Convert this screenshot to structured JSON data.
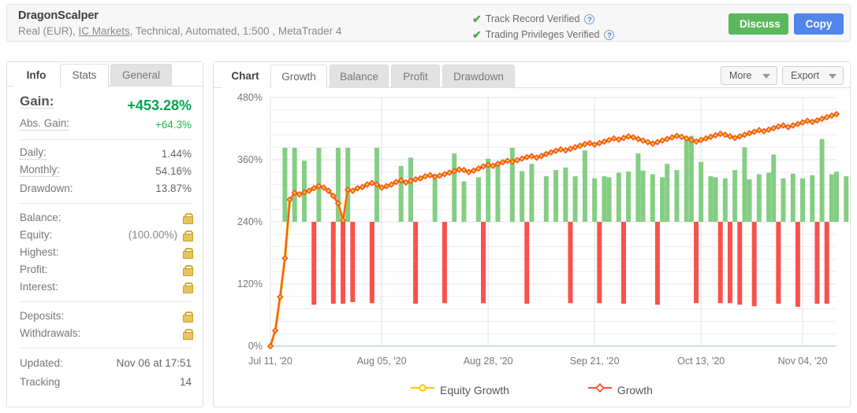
{
  "header": {
    "title": "DragonScalper",
    "subtitle_parts": {
      "pre": "Real (EUR), ",
      "broker": "IC Markets",
      "post": ", Technical, Automated, 1:500 , MetaTrader 4"
    },
    "verified": [
      {
        "label": "Track Record Verified",
        "help": "?"
      },
      {
        "label": "Trading Privileges Verified",
        "help": "?"
      }
    ],
    "discuss_label": "Discuss",
    "copy_label": "Copy",
    "discuss_color": "#5cb85c",
    "copy_color": "#5285ec"
  },
  "left_panel": {
    "tabs": [
      {
        "label": "Info",
        "state": "title"
      },
      {
        "label": "Stats",
        "state": "active"
      },
      {
        "label": "General",
        "state": "inactive"
      }
    ],
    "gain": {
      "label": "Gain:",
      "value": "+453.28%"
    },
    "abs_gain": {
      "label": "Abs. Gain:",
      "value": "+64.3%"
    },
    "metrics": [
      {
        "label": "Daily:",
        "value": "1.44%"
      },
      {
        "label": "Monthly:",
        "value": "54.16%"
      },
      {
        "label": "Drawdown:",
        "value": "13.87%"
      }
    ],
    "locked": [
      {
        "label": "Balance:",
        "value": "",
        "lock": "lock-icon"
      },
      {
        "label": "Equity:",
        "value": "(100.00%)",
        "lock": "lock-icon"
      },
      {
        "label": "Highest:",
        "value": "",
        "lock": "lock-icon"
      },
      {
        "label": "Profit:",
        "value": "",
        "lock": "lock-icon"
      },
      {
        "label": "Interest:",
        "value": "",
        "lock": "lock-icon"
      }
    ],
    "funds": [
      {
        "label": "Deposits:",
        "value": "",
        "lock": "lock-icon"
      },
      {
        "label": "Withdrawals:",
        "value": "",
        "lock": "lock-icon"
      }
    ],
    "footer": [
      {
        "label": "Updated:",
        "value": "Nov 06 at 17:51"
      },
      {
        "label": "Tracking",
        "value": "14"
      }
    ]
  },
  "right_panel": {
    "tabs": [
      {
        "label": "Chart",
        "state": "title"
      },
      {
        "label": "Growth",
        "state": "active"
      },
      {
        "label": "Balance",
        "state": "inactive"
      },
      {
        "label": "Profit",
        "state": "inactive"
      },
      {
        "label": "Drawdown",
        "state": "inactive"
      }
    ],
    "more_label": "More",
    "export_label": "Export"
  },
  "chart_data": {
    "type": "line",
    "title": "Growth",
    "xlabel": "",
    "ylabel": "",
    "grid": true,
    "legend_position": "bottom",
    "ylim": [
      0,
      480
    ],
    "yticks": [
      0,
      120,
      240,
      360,
      480
    ],
    "ytick_labels": [
      "0%",
      "120%",
      "240%",
      "360%",
      "480%"
    ],
    "xtick_labels": [
      "Jul 11, '20",
      "Aug 05, '20",
      "Aug 28, '20",
      "Sep 21, '20",
      "Oct 13, '20",
      "Nov 04, '20"
    ],
    "xtick_positions": [
      0,
      23,
      45,
      67,
      89,
      110
    ],
    "x_count": 118,
    "bar_baseline": 240,
    "colors": {
      "growth_line": "#f4542e",
      "growth_marker_fill": "#ffd400",
      "equity_growth": "#ffc600",
      "bar_up": "#84ce84",
      "bar_down": "#f9514b",
      "grid": "#ededed",
      "axis": "#c6d0e8"
    },
    "series": [
      {
        "name": "Equity Growth",
        "color": "#ffc600",
        "type": "line",
        "note": "overlaps Growth line"
      },
      {
        "name": "Growth",
        "color": "#f4542e",
        "type": "line",
        "values": [
          0,
          30,
          95,
          170,
          283,
          296,
          293,
          297,
          300,
          305,
          309,
          306,
          300,
          290,
          276,
          243,
          302,
          300,
          305,
          307,
          312,
          315,
          312,
          306,
          309,
          312,
          317,
          320,
          316,
          319,
          322,
          324,
          328,
          330,
          327,
          329,
          332,
          335,
          338,
          341,
          340,
          336,
          339,
          343,
          347,
          350,
          348,
          352,
          355,
          358,
          356,
          359,
          362,
          365,
          367,
          364,
          367,
          371,
          374,
          377,
          380,
          378,
          381,
          384,
          387,
          390,
          392,
          389,
          392,
          395,
          398,
          401,
          399,
          402,
          405,
          403,
          400,
          397,
          394,
          391,
          394,
          397,
          400,
          403,
          406,
          404,
          401,
          398,
          395,
          398,
          401,
          404,
          407,
          410,
          408,
          405,
          402,
          405,
          408,
          411,
          414,
          417,
          415,
          418,
          421,
          424,
          426,
          423,
          426,
          429,
          432,
          435,
          433,
          436,
          439,
          442,
          445,
          448
        ]
      },
      {
        "name": "Up bars",
        "color": "#84ce84",
        "type": "bar",
        "note": "green bars drawn upward from 240% baseline"
      },
      {
        "name": "Down bars",
        "color": "#f9514b",
        "type": "bar",
        "note": "red bars drawn downward from 240% baseline"
      }
    ],
    "bars": [
      {
        "i": 3,
        "up": 143
      },
      {
        "i": 5,
        "up": 143
      },
      {
        "i": 7,
        "up": 118
      },
      {
        "i": 10,
        "up": 143
      },
      {
        "i": 14,
        "up": 143
      },
      {
        "i": 16,
        "up": 143
      },
      {
        "i": 22,
        "up": 143
      },
      {
        "i": 27,
        "up": 108
      },
      {
        "i": 29,
        "up": 124
      },
      {
        "i": 34,
        "up": 92
      },
      {
        "i": 38,
        "up": 132
      },
      {
        "i": 40,
        "up": 78
      },
      {
        "i": 43,
        "up": 86
      },
      {
        "i": 45,
        "up": 122
      },
      {
        "i": 47,
        "up": 112
      },
      {
        "i": 50,
        "up": 143
      },
      {
        "i": 52,
        "up": 98
      },
      {
        "i": 54,
        "up": 112
      },
      {
        "i": 57,
        "up": 88
      },
      {
        "i": 59,
        "up": 100
      },
      {
        "i": 61,
        "up": 105
      },
      {
        "i": 63,
        "up": 88
      },
      {
        "i": 65,
        "up": 138
      },
      {
        "i": 67,
        "up": 84
      },
      {
        "i": 69,
        "up": 88
      },
      {
        "i": 70,
        "up": 86
      },
      {
        "i": 72,
        "up": 95
      },
      {
        "i": 74,
        "up": 97
      },
      {
        "i": 76,
        "up": 132
      },
      {
        "i": 77,
        "up": 99
      },
      {
        "i": 79,
        "up": 92
      },
      {
        "i": 81,
        "up": 86
      },
      {
        "i": 82,
        "up": 112
      },
      {
        "i": 84,
        "up": 100
      },
      {
        "i": 86,
        "up": 160
      },
      {
        "i": 87,
        "up": 166
      },
      {
        "i": 89,
        "up": 116
      },
      {
        "i": 91,
        "up": 88
      },
      {
        "i": 92,
        "up": 86
      },
      {
        "i": 94,
        "up": 84
      },
      {
        "i": 96,
        "up": 100
      },
      {
        "i": 98,
        "up": 144
      },
      {
        "i": 99,
        "up": 82
      },
      {
        "i": 101,
        "up": 92
      },
      {
        "i": 103,
        "up": 95
      },
      {
        "i": 104,
        "up": 130
      },
      {
        "i": 106,
        "up": 84
      },
      {
        "i": 108,
        "up": 93
      },
      {
        "i": 110,
        "up": 84
      },
      {
        "i": 112,
        "up": 90
      },
      {
        "i": 114,
        "up": 160
      },
      {
        "i": 116,
        "up": 92
      },
      {
        "i": 117,
        "up": 97
      },
      {
        "i": 119,
        "up": 88
      },
      {
        "i": 121,
        "up": 103
      },
      {
        "i": 9,
        "down": 160
      },
      {
        "i": 13,
        "down": 158
      },
      {
        "i": 15,
        "down": 158
      },
      {
        "i": 17,
        "down": 155
      },
      {
        "i": 21,
        "down": 157
      },
      {
        "i": 30,
        "down": 158
      },
      {
        "i": 36,
        "down": 157
      },
      {
        "i": 44,
        "down": 157
      },
      {
        "i": 53,
        "down": 158
      },
      {
        "i": 62,
        "down": 157
      },
      {
        "i": 68,
        "down": 157
      },
      {
        "i": 73,
        "down": 158
      },
      {
        "i": 80,
        "down": 160
      },
      {
        "i": 88,
        "down": 157
      },
      {
        "i": 93,
        "down": 157
      },
      {
        "i": 95,
        "down": 157
      },
      {
        "i": 97,
        "down": 160
      },
      {
        "i": 100,
        "down": 163
      },
      {
        "i": 105,
        "down": 158
      },
      {
        "i": 109,
        "down": 164
      },
      {
        "i": 113,
        "down": 158
      },
      {
        "i": 115,
        "down": 158
      }
    ],
    "legend": [
      {
        "label": "Equity Growth",
        "color": "#ffc600"
      },
      {
        "label": "Growth",
        "color": "#f4542e"
      }
    ]
  }
}
